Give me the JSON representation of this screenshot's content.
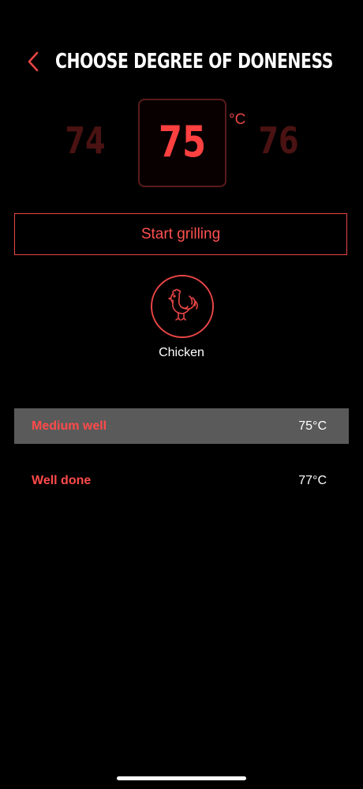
{
  "header": {
    "title": "CHOOSE DEGREE OF DONENESS",
    "back_icon": "chevron-left-icon"
  },
  "temperature_picker": {
    "previous": "74",
    "current": "75",
    "next": "76",
    "unit": "°C"
  },
  "start_button": {
    "label": "Start grilling"
  },
  "food": {
    "label": "Chicken",
    "icon": "rooster-icon"
  },
  "doneness_options": [
    {
      "name": "Medium well",
      "temperature": "75°C",
      "selected": true
    },
    {
      "name": "Well done",
      "temperature": "77°C",
      "selected": false
    }
  ],
  "colors": {
    "accent": "#e84545",
    "background": "#000000",
    "selected_row": "#5a5a5a",
    "inactive_number": "#4a1212"
  }
}
